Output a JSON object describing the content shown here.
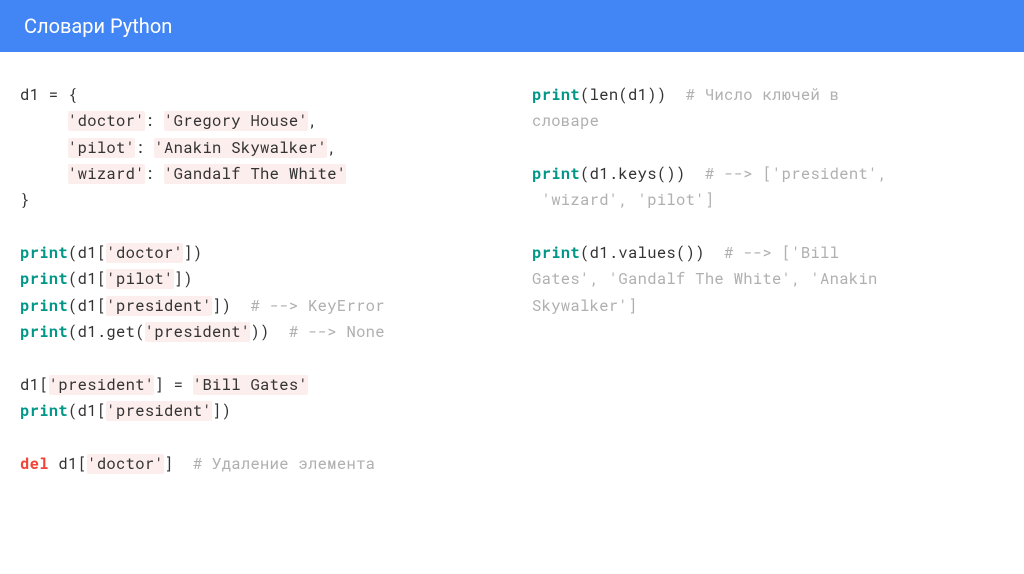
{
  "header": {
    "title": "Словари Python"
  },
  "left": {
    "l1": "d1 = {",
    "l2a": "     ",
    "l2b": "'doctor'",
    "l2c": ": ",
    "l2d": "'Gregory House'",
    "l2e": ",",
    "l3a": "     ",
    "l3b": "'pilot'",
    "l3c": ": ",
    "l3d": "'Anakin Skywalker'",
    "l3e": ",",
    "l4a": "     ",
    "l4b": "'wizard'",
    "l4c": ": ",
    "l4d": "'Gandalf The White'",
    "l5": "}",
    "l7a": "print",
    "l7b": "(d1[",
    "l7c": "'doctor'",
    "l7d": "])",
    "l8a": "print",
    "l8b": "(d1[",
    "l8c": "'pilot'",
    "l8d": "])",
    "l9a": "print",
    "l9b": "(d1[",
    "l9c": "'president'",
    "l9d": "])  ",
    "l9e": "# --> KeyError",
    "l10a": "print",
    "l10b": "(d1.get(",
    "l10c": "'president'",
    "l10d": "))  ",
    "l10e": "# --> None",
    "l12a": "d1[",
    "l12b": "'president'",
    "l12c": "] = ",
    "l12d": "'Bill Gates'",
    "l13a": "print",
    "l13b": "(d1[",
    "l13c": "'president'",
    "l13d": "])",
    "l15a": "del",
    "l15b": " d1[",
    "l15c": "'doctor'",
    "l15d": "]  ",
    "l15e": "# Удаление элемента"
  },
  "right": {
    "r1a": "print",
    "r1b": "(len(d1))  ",
    "r1c": "# Число ключей в",
    "r2": "словаре",
    "r4a": "print",
    "r4b": "(d1.keys())  ",
    "r4c": "# --> ['president',",
    "r5": " 'wizard', 'pilot']",
    "r7a": "print",
    "r7b": "(d1.values())  ",
    "r7c": "# --> ['Bill",
    "r8": "Gates', 'Gandalf The White', 'Anakin",
    "r9": "Skywalker']"
  }
}
